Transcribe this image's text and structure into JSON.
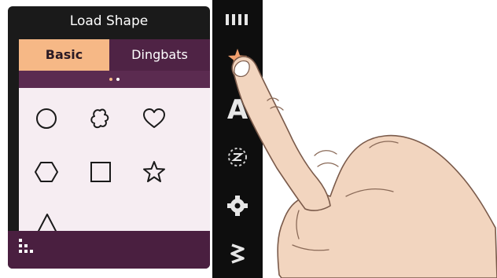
{
  "panel": {
    "title": "Load Shape",
    "tabs": [
      {
        "label": "Basic",
        "active": true
      },
      {
        "label": "Dingbats",
        "active": false
      }
    ],
    "page_indicator": {
      "pages": 2,
      "current": 1
    },
    "shapes": [
      "circle",
      "flower",
      "heart",
      "hexagon",
      "square",
      "star",
      "triangle"
    ],
    "footer_icon": "dots-grid-icon"
  },
  "toolbar": {
    "items": [
      {
        "icon": "bars-icon"
      },
      {
        "icon": "star-icon",
        "active": true
      },
      {
        "icon": "text-icon",
        "text": "A"
      },
      {
        "icon": "rotate-icon"
      },
      {
        "icon": "gear-icon"
      },
      {
        "icon": "zigzag-icon"
      }
    ]
  },
  "overlay": {
    "icon": "pointing-hand-icon"
  },
  "colors": {
    "accent": "#f6b886",
    "panel_purple": "#4f2345",
    "grid_background": "#f6edf2",
    "panel_dark": "#1a1a1a",
    "toolbar_dark": "#0e0e0e"
  }
}
